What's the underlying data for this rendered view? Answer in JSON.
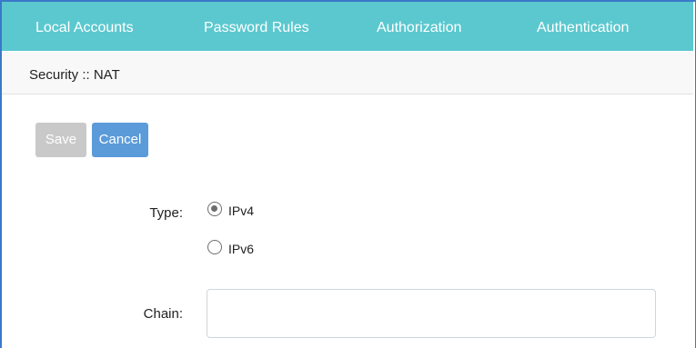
{
  "topnav": {
    "items": [
      {
        "label": "Local Accounts"
      },
      {
        "label": "Password Rules"
      },
      {
        "label": "Authorization"
      },
      {
        "label": "Authentication"
      }
    ]
  },
  "breadcrumb": "Security :: NAT",
  "toolbar": {
    "save_label": "Save",
    "cancel_label": "Cancel"
  },
  "form": {
    "type_label": "Type:",
    "type_options": [
      {
        "label": "IPv4",
        "checked": true
      },
      {
        "label": "IPv6",
        "checked": false
      }
    ],
    "chain_label": "Chain:",
    "chain_value": "",
    "chain_placeholder": ""
  },
  "colors": {
    "nav_background": "#5bc8cf",
    "save_disabled": "#c9c9c9",
    "cancel_button": "#5b9bd9",
    "frame_border": "#3b78c9"
  }
}
